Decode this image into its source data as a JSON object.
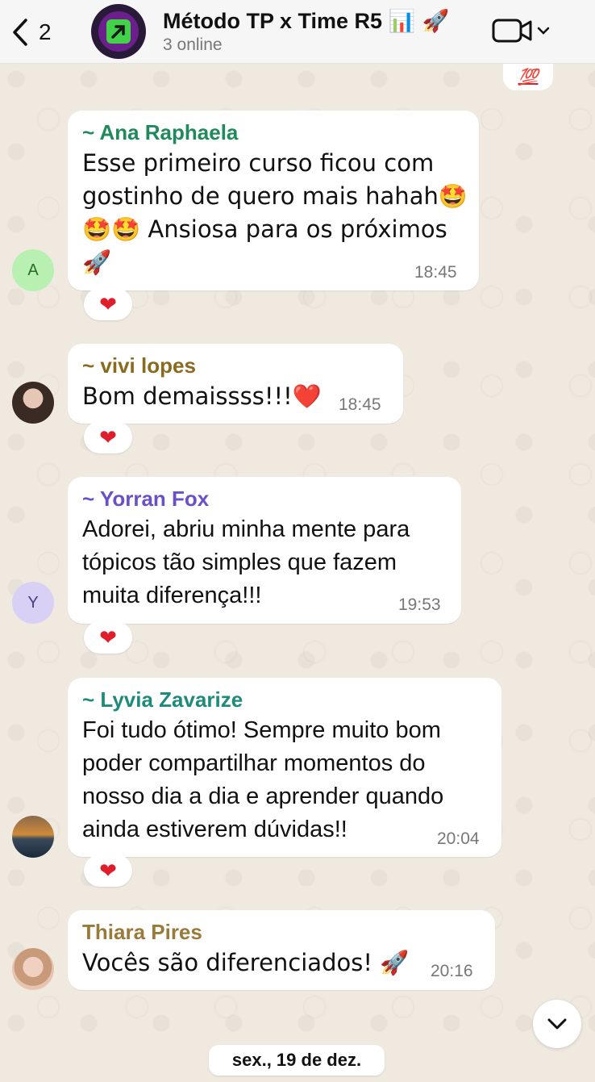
{
  "header": {
    "back_count": "2",
    "title": "Método TP x Time R5",
    "title_emojis": "📊 🚀",
    "subtitle": "3 online"
  },
  "partial_previous_message": {
    "reaction_symbol": "💯"
  },
  "messages": [
    {
      "sender": "~ Ana Raphaela",
      "sender_color": "#1f8a5c",
      "lines": [
        "Esse primeiro curso ficou com",
        "gostinho de quero mais hahah🤩",
        "🤩🤩 Ansiosa para os próximos",
        "🚀"
      ],
      "time": "18:45",
      "reaction": "❤",
      "avatar_initial": "A",
      "avatar_color": "#b7f0b1"
    },
    {
      "sender": "~ vivi lopes",
      "sender_color": "#8a6a1f",
      "lines": [
        "Bom demaissss!!!❤️"
      ],
      "time": "18:45",
      "reaction": "❤",
      "avatar_initial": "",
      "avatar_color": "#c9a99a"
    },
    {
      "sender": "~ Yorran Fox",
      "sender_color": "#6a4fc9",
      "lines": [
        "Adorei, abriu minha mente para",
        "tópicos tão simples que fazem",
        "muita diferença!!!"
      ],
      "time": "19:53",
      "reaction": "❤",
      "avatar_initial": "Y",
      "avatar_color": "#d9d0f5"
    },
    {
      "sender": "~ Lyvia Zavarize",
      "sender_color": "#1f8a7a",
      "lines": [
        "Foi tudo ótimo! Sempre muito bom",
        "poder compartilhar momentos do",
        "nosso dia a dia e aprender quando",
        "ainda estiverem dúvidas!!"
      ],
      "time": "20:04",
      "reaction": "❤",
      "avatar_initial": "",
      "avatar_color": "#d08a3a"
    },
    {
      "sender": "Thiara Pires",
      "sender_color": "#9a7a3a",
      "lines": [
        "Vocês são diferenciados! 🚀"
      ],
      "time": "20:16",
      "reaction": "",
      "avatar_initial": "",
      "avatar_color": "#e8c4b0"
    }
  ],
  "date_separator": "sex., 19 de dez."
}
